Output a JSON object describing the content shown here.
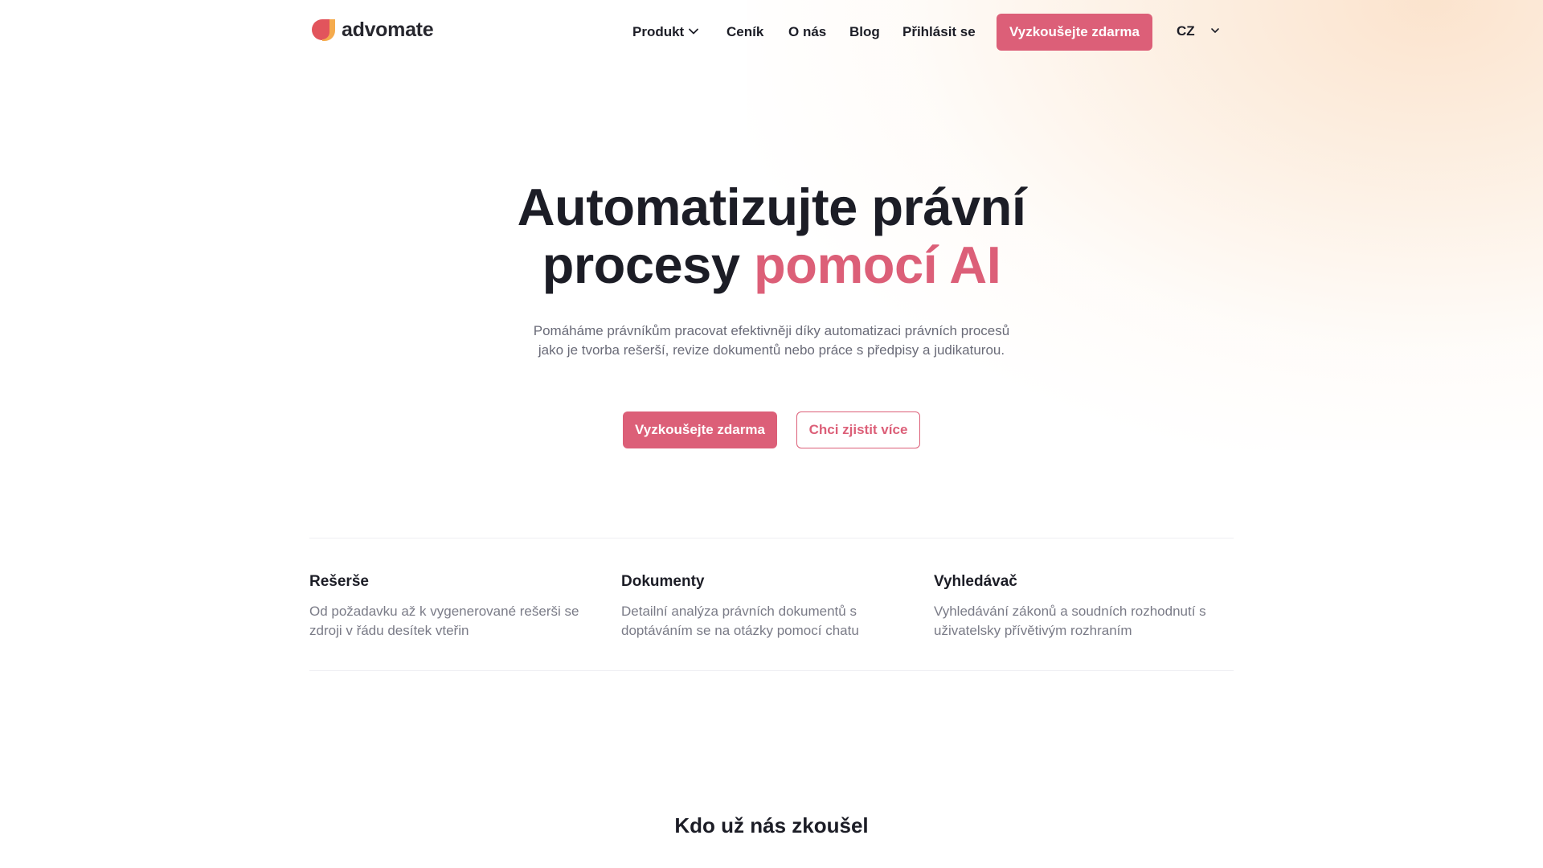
{
  "brand": {
    "name": "advomate",
    "logo_icon": "advomate-logo-mark",
    "accent_color": "#dc5f78",
    "logo_colors": [
      "#e2545c",
      "#f4a23a"
    ]
  },
  "nav": {
    "items": [
      {
        "label": "Produkt",
        "has_dropdown": true
      },
      {
        "label": "Ceník"
      },
      {
        "label": "O nás"
      },
      {
        "label": "Blog"
      },
      {
        "label": "Přihlásit se"
      }
    ],
    "cta_label": "Vyzkoušejte zdarma",
    "language": "CZ"
  },
  "hero": {
    "title_line1": "Automatizujte právní",
    "title_line2_plain": "procesy ",
    "title_line2_accent": "pomocí AI",
    "subtitle_line1": "Pomáháme právníkům pracovat efektivněji díky automatizaci právních procesů",
    "subtitle_line2": "jako je tvorba rešerší, revize dokumentů nebo práce s předpisy a judikaturou.",
    "primary_cta": "Vyzkoušejte zdarma",
    "secondary_cta": "Chci zjistit více"
  },
  "features": [
    {
      "title": "Rešerše",
      "desc_line1": "Od požadavku až k vygenerované rešerši se",
      "desc_line2": "zdroji v řádu desítek vteřin"
    },
    {
      "title": "Dokumenty",
      "desc_line1": "Detailní analýza právních dokumentů s",
      "desc_line2": "doptáváním se na otázky pomocí chatu"
    },
    {
      "title": "Vyhledávač",
      "desc_line1": "Vyhledávání zákonů a soudních rozhodnutí s",
      "desc_line2": "uživatelsky přívětivým rozhraním"
    }
  ],
  "testimonials": {
    "heading": "Kdo už nás zkoušel"
  }
}
